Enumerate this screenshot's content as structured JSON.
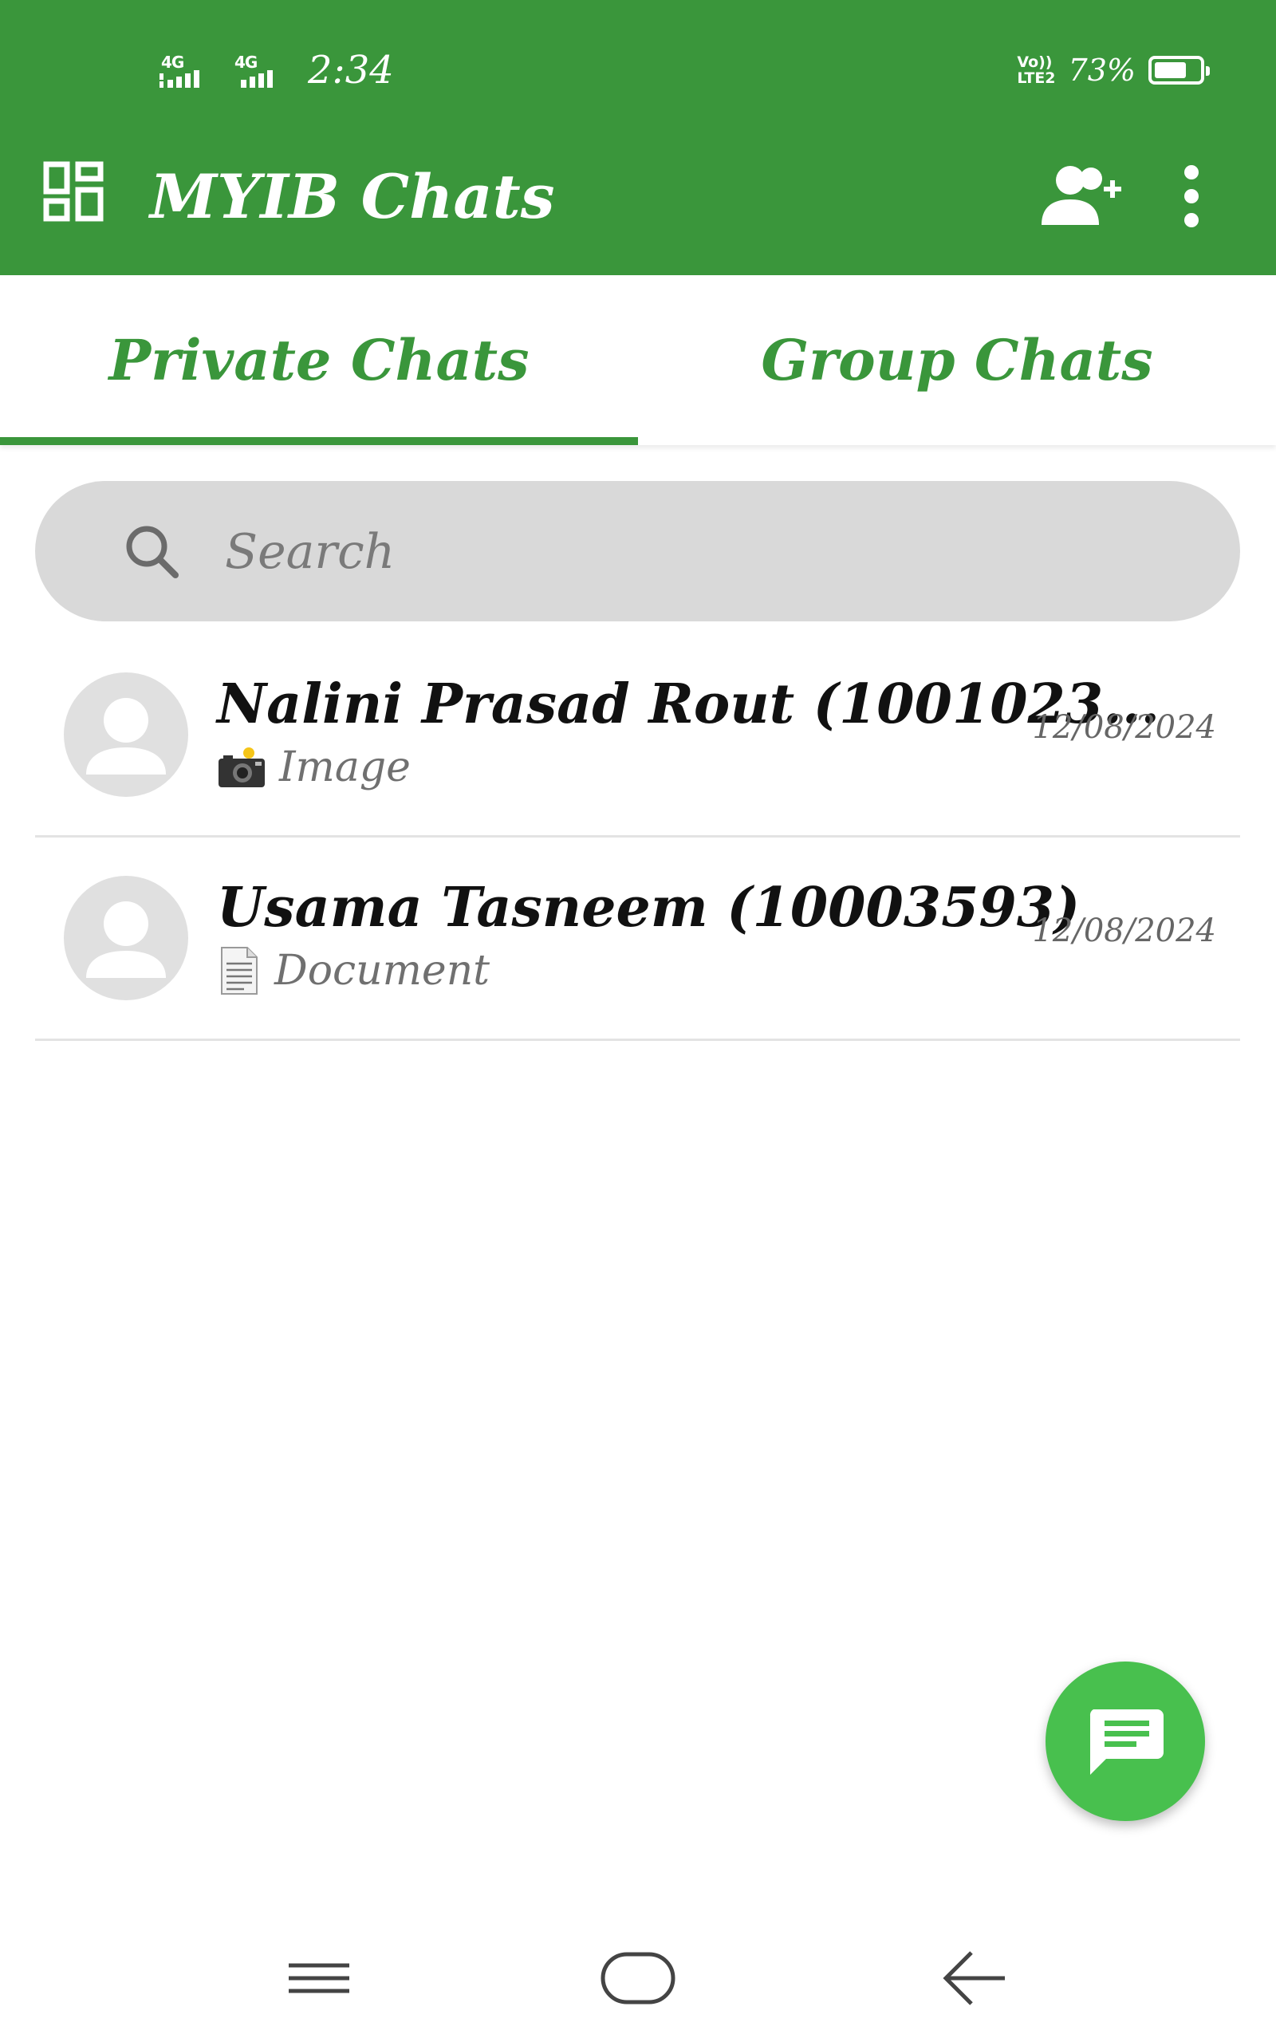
{
  "status_bar": {
    "network_1": "4G",
    "network_2": "4G",
    "time": "2:34",
    "volte_line1": "Vo))",
    "volte_line2": "LTE2",
    "battery_percent": "73%",
    "battery_level": 0.73
  },
  "app_bar": {
    "title": "MYIB Chats",
    "left_icon": "dashboard-grid-icon",
    "right_icons": [
      "add-user-icon",
      "more-vertical-icon"
    ]
  },
  "tabs": [
    {
      "label": "Private Chats",
      "selected": true
    },
    {
      "label": "Group Chats",
      "selected": false
    }
  ],
  "search": {
    "placeholder": "Search",
    "value": ""
  },
  "chats": [
    {
      "name": "Nalini Prasad Rout (1001023...",
      "preview_icon": "camera-icon",
      "preview": "Image",
      "date": "12/08/2024"
    },
    {
      "name": "Usama Tasneem (10003593)",
      "preview_icon": "document-icon",
      "preview": "Document",
      "date": "12/08/2024"
    }
  ],
  "fab": {
    "icon": "new-chat-icon"
  },
  "nav_bar": {
    "icons": [
      "recent-apps-icon",
      "home-icon",
      "back-icon"
    ]
  },
  "colors": {
    "primary": "#3a963b",
    "fab": "#48c04e",
    "search_bg": "#d9d9d9",
    "avatar_bg": "#e0e0e0"
  }
}
